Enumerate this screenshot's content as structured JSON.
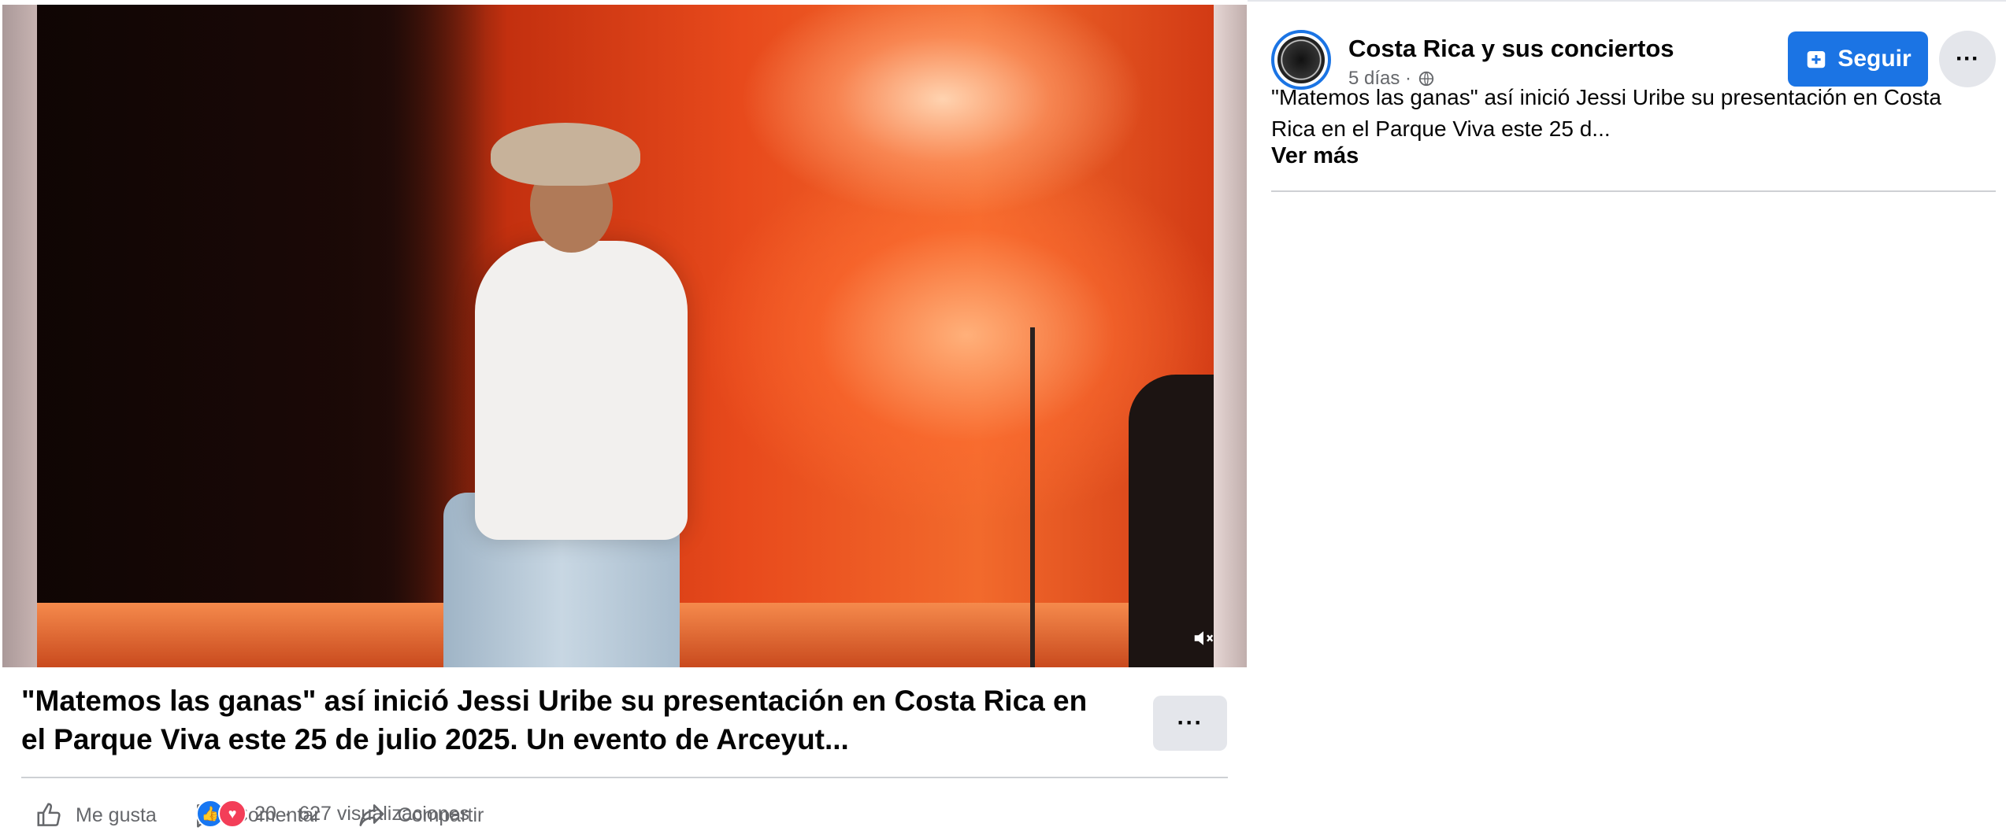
{
  "post": {
    "title": "\"Matemos las ganas\" así inició Jessi Uribe su presentación en Costa Rica en el Parque Viva este 25 de julio 2025. Un evento de Arceyut...",
    "more_label": "···",
    "actions": [
      {
        "label": "Me gusta",
        "icon": "like-icon"
      },
      {
        "label": "Comentar",
        "icon": "comment-icon"
      },
      {
        "label": "Compartir",
        "icon": "share-icon"
      }
    ],
    "reaction_count": "20",
    "separator": "·",
    "views": "627 visualizaciones"
  },
  "page": {
    "name": "Costa Rica y sus conciertos",
    "time": "5 días ·",
    "follow_label": "Seguir",
    "more_label": "···",
    "description": "\"Matemos las ganas\" así inició Jessi Uribe su presentación en Costa Rica en el Parque Viva este 25 d...",
    "see_more": "Ver más"
  },
  "colors": {
    "accent": "#1b74e4",
    "secondary_text": "#65676b",
    "divider": "#ced0d4"
  }
}
